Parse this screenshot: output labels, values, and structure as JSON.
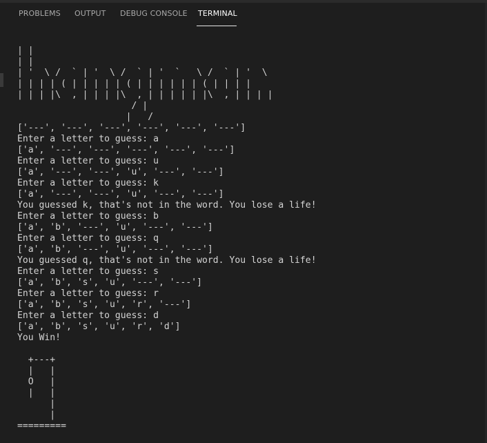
{
  "panel": {
    "tabs": [
      {
        "label": "PROBLEMS",
        "active": false
      },
      {
        "label": "OUTPUT",
        "active": false
      },
      {
        "label": "DEBUG CONSOLE",
        "active": false
      },
      {
        "label": "TERMINAL",
        "active": true
      }
    ]
  },
  "terminal": {
    "lines": [
      "| |",
      "| |",
      "| '  \\ /  ` | '  \\ /  ` | '  `   \\ /  ` | '  \\",
      "| | | | ( | | | | | ( | | | | | | ( | | | |",
      "| | | |\\  , | | | |\\  , | | | | | |\\  , | | | |",
      "                     / |",
      "                    |   /",
      "['---', '---', '---', '---', '---', '---']",
      "Enter a letter to guess: a",
      "['a', '---', '---', '---', '---', '---']",
      "Enter a letter to guess: u",
      "['a', '---', '---', 'u', '---', '---']",
      "Enter a letter to guess: k",
      "['a', '---', '---', 'u', '---', '---']",
      "You guessed k, that's not in the word. You lose a life!",
      "Enter a letter to guess: b",
      "['a', 'b', '---', 'u', '---', '---']",
      "Enter a letter to guess: q",
      "['a', 'b', '---', 'u', '---', '---']",
      "You guessed q, that's not in the word. You lose a life!",
      "Enter a letter to guess: s",
      "['a', 'b', 's', 'u', '---', '---']",
      "Enter a letter to guess: r",
      "['a', 'b', 's', 'u', 'r', '---']",
      "Enter a letter to guess: d",
      "['a', 'b', 's', 'u', 'r', 'd']",
      "You Win!",
      "",
      "  +---+",
      "  |   |",
      "  O   |",
      "  |   |",
      "      |",
      "      |",
      "========="
    ]
  }
}
